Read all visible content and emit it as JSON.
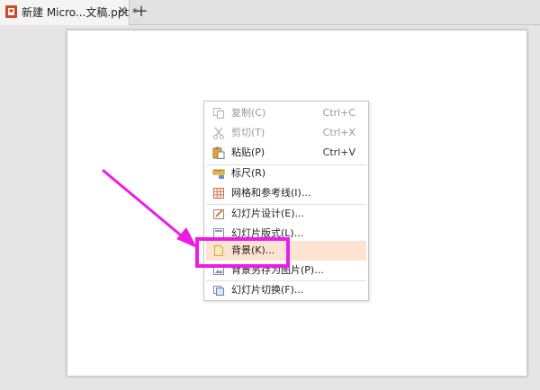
{
  "tabs": [
    {
      "title": "新建 Micro...文稿.ppt *",
      "close_glyph": "✕",
      "icon": "ppt-file-icon"
    }
  ],
  "new_tab_glyph": "+",
  "context_menu": {
    "items": [
      {
        "id": "copy",
        "label": "复制(C)",
        "shortcut": "Ctrl+C",
        "icon": "copy-icon",
        "disabled": true
      },
      {
        "id": "cut",
        "label": "剪切(T)",
        "shortcut": "Ctrl+X",
        "icon": "scissors-icon",
        "disabled": true
      },
      {
        "id": "paste",
        "label": "粘贴(P)",
        "shortcut": "Ctrl+V",
        "icon": "paste-icon",
        "disabled": false
      },
      {
        "id": "ruler",
        "label": "标尺(R)",
        "shortcut": "",
        "icon": "ruler-icon",
        "disabled": false
      },
      {
        "id": "grid",
        "label": "网格和参考线(I)...",
        "shortcut": "",
        "icon": "grid-icon",
        "disabled": false
      },
      {
        "id": "slide-design",
        "label": "幻灯片设计(E)...",
        "shortcut": "",
        "icon": "slide-design-icon",
        "disabled": false
      },
      {
        "id": "slide-layout",
        "label": "幻灯片版式(L)...",
        "shortcut": "",
        "icon": "slide-layout-icon",
        "disabled": false
      },
      {
        "id": "background",
        "label": "背景(K)...",
        "shortcut": "",
        "icon": "background-icon",
        "disabled": false,
        "highlighted": true
      },
      {
        "id": "save-bg",
        "label": "背景另存为图片(P)...",
        "shortcut": "",
        "icon": "save-image-icon",
        "disabled": false
      },
      {
        "id": "transition",
        "label": "幻灯片切换(F)...",
        "shortcut": "",
        "icon": "transition-icon",
        "disabled": false
      }
    ]
  },
  "colors": {
    "annotation": "#ec1ce6",
    "menu_highlight": "#fde3d2",
    "ppt_icon": "#d24726"
  }
}
